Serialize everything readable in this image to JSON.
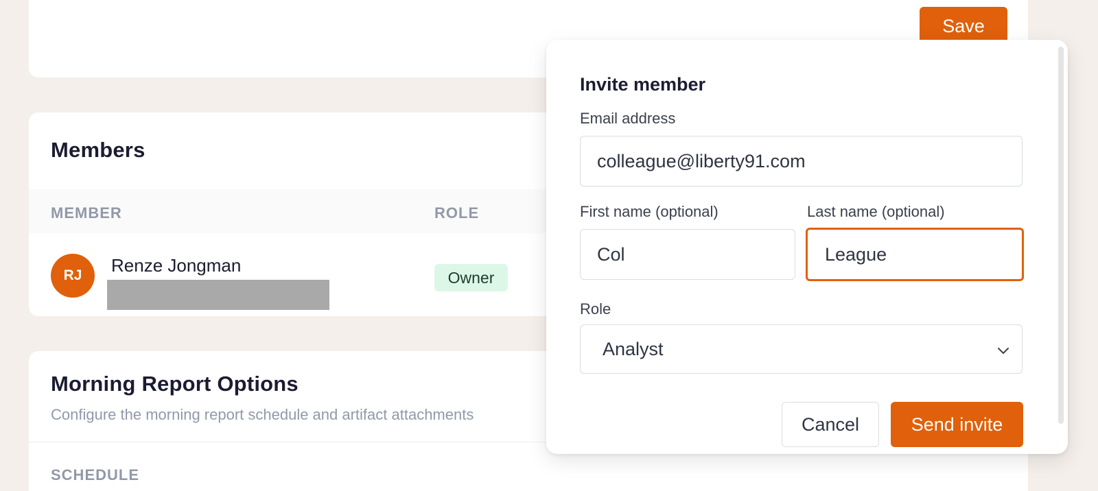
{
  "top_card": {
    "save_label": "Save"
  },
  "members": {
    "title": "Members",
    "columns": [
      "MEMBER",
      "ROLE"
    ],
    "rows": [
      {
        "initials": "RJ",
        "name": "Renze Jongman",
        "role": "Owner"
      }
    ]
  },
  "morning_report": {
    "title": "Morning Report Options",
    "description": "Configure the morning report schedule and artifact attachments",
    "schedule_label": "SCHEDULE"
  },
  "invite_modal": {
    "title": "Invite member",
    "email_label": "Email address",
    "email_value": "colleague@liberty91.com",
    "first_name_label": "First name (optional)",
    "first_name_value": "Col",
    "last_name_label": "Last name (optional)",
    "last_name_value": "League",
    "role_label": "Role",
    "role_value": "Analyst",
    "cancel_label": "Cancel",
    "send_label": "Send invite"
  },
  "colors": {
    "accent": "#e0600b",
    "background": "#f4efea",
    "owner_badge_bg": "#dcf7e8"
  },
  "icons": {
    "select_arrow": "chevron-down-icon"
  }
}
